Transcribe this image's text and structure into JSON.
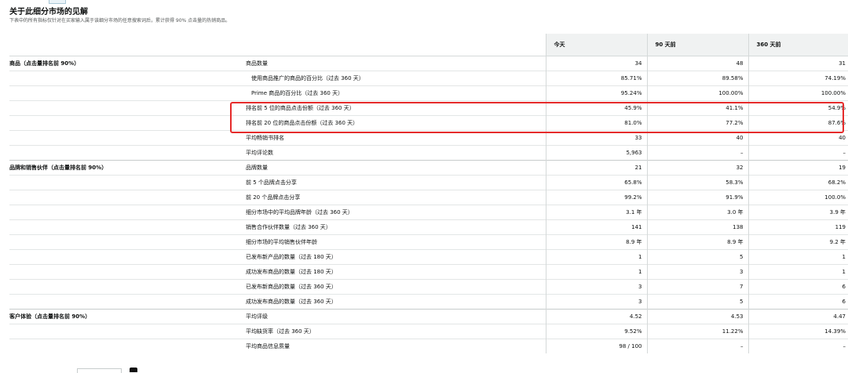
{
  "header": {
    "title": "关于此细分市场的见解",
    "subtitle": "下表中的所有指标仅针对在买家输入属于该细分市场的任意搜索词后，累计获得 90% 点击量的热销商品。"
  },
  "columns": [
    "今天",
    "90 天前",
    "360 天前"
  ],
  "rows": [
    {
      "section": "商品（点击量排名前 90%）",
      "metric": "商品数量",
      "indent": false,
      "values": [
        "34",
        "48",
        "31"
      ]
    },
    {
      "section": "",
      "metric": "使用商品推广的商品的百分比（过去 360 天）",
      "indent": true,
      "values": [
        "85.71%",
        "89.58%",
        "74.19%"
      ]
    },
    {
      "section": "",
      "metric": "Prime 商品的百分比（过去 360 天）",
      "indent": true,
      "values": [
        "95.24%",
        "100.00%",
        "100.00%"
      ]
    },
    {
      "section": "",
      "metric": "排名前 5 位的商品点击份额（过去 360 天）",
      "indent": false,
      "values": [
        "45.9%",
        "41.1%",
        "54.9%"
      ]
    },
    {
      "section": "",
      "metric": "排名前 20 位的商品点击份额（过去 360 天）",
      "indent": false,
      "values": [
        "81.0%",
        "77.2%",
        "87.6%"
      ]
    },
    {
      "section": "",
      "metric": "平均畅销书排名",
      "indent": false,
      "values": [
        "33",
        "40",
        "40"
      ]
    },
    {
      "section": "",
      "metric": "平均评论数",
      "indent": false,
      "values": [
        "5,963",
        "–",
        "–"
      ]
    },
    {
      "section": "品牌和销售伙伴（点击量排名前 90%）",
      "metric": "品牌数量",
      "indent": false,
      "values": [
        "21",
        "32",
        "19"
      ]
    },
    {
      "section": "",
      "metric": "前 5 个品牌点击分享",
      "indent": false,
      "values": [
        "65.8%",
        "58.3%",
        "68.2%"
      ]
    },
    {
      "section": "",
      "metric": "前 20 个品牌点击分享",
      "indent": false,
      "values": [
        "99.2%",
        "91.9%",
        "100.0%"
      ]
    },
    {
      "section": "",
      "metric": "细分市场中的平均品牌年龄（过去 360 天）",
      "indent": false,
      "values": [
        "3.1 年",
        "3.0 年",
        "3.9 年"
      ]
    },
    {
      "section": "",
      "metric": "销售合作伙伴数量（过去 360 天）",
      "indent": false,
      "values": [
        "141",
        "138",
        "119"
      ]
    },
    {
      "section": "",
      "metric": "细分市场的平均销售伙伴年龄",
      "indent": false,
      "values": [
        "8.9 年",
        "8.9 年",
        "9.2 年"
      ]
    },
    {
      "section": "",
      "metric": "已发布新产品的数量（过去 180 天）",
      "indent": false,
      "values": [
        "1",
        "5",
        "1"
      ]
    },
    {
      "section": "",
      "metric": "成功发布商品的数量（过去 180 天）",
      "indent": false,
      "values": [
        "1",
        "3",
        "1"
      ]
    },
    {
      "section": "",
      "metric": "已发布新商品的数量（过去 360 天）",
      "indent": false,
      "values": [
        "3",
        "7",
        "6"
      ]
    },
    {
      "section": "",
      "metric": "成功发布商品的数量（过去 360 天）",
      "indent": false,
      "values": [
        "3",
        "5",
        "6"
      ]
    },
    {
      "section": "客户体验（点击量排名前 90%）",
      "metric": "平均评级",
      "indent": false,
      "values": [
        "4.52",
        "4.53",
        "4.47"
      ]
    },
    {
      "section": "",
      "metric": "平均缺货率（过去 360 天）",
      "indent": false,
      "values": [
        "9.52%",
        "11.22%",
        "14.39%"
      ]
    },
    {
      "section": "",
      "metric": "平均商品信息质量",
      "indent": false,
      "values": [
        "98 / 100",
        "–",
        "–"
      ]
    }
  ],
  "highlight_color": "#e52b2b"
}
